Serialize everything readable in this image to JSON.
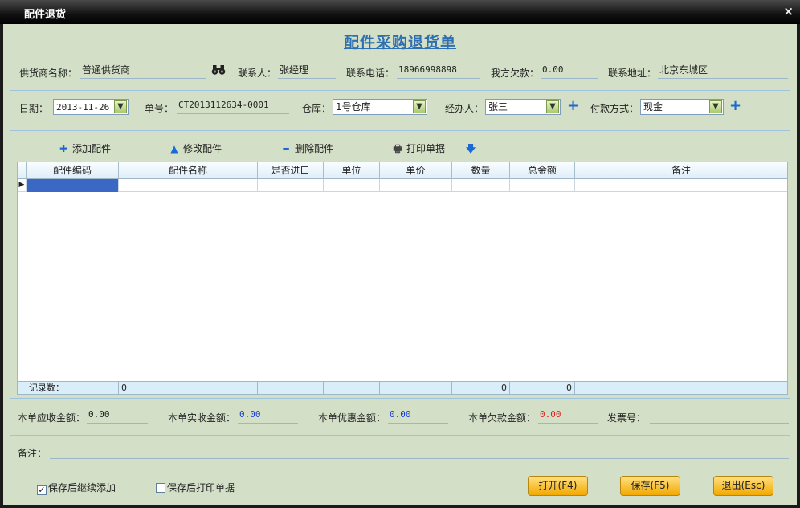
{
  "window": {
    "title": "配件退货",
    "close": "×"
  },
  "heading": "配件采购退货单",
  "row1": {
    "supplier_label": "供货商名称：",
    "supplier_value": "普通供货商",
    "contact_label": "联系人：",
    "contact_value": "张经理",
    "phone_label": "联系电话：",
    "phone_value": "18966998898",
    "owe_label": "我方欠款：",
    "owe_value": "0.00",
    "address_label": "联系地址：",
    "address_value": "北京东城区"
  },
  "row2": {
    "date_label": "日期：",
    "date_value": "2013-11-26",
    "no_label": "单号：",
    "no_value": "CT2013112634-0001",
    "warehouse_label": "仓库：",
    "warehouse_value": "1号仓库",
    "handler_label": "经办人：",
    "handler_value": "张三",
    "payment_label": "付款方式：",
    "payment_value": "现金"
  },
  "toolbar": {
    "add": "添加配件",
    "edit": "修改配件",
    "delete": "删除配件",
    "print": "打印单据"
  },
  "grid": {
    "columns": [
      "配件编码",
      "配件名称",
      "是否进口",
      "单位",
      "单价",
      "数量",
      "总金额",
      "备注"
    ],
    "footer": {
      "label": "记录数：",
      "count": "0",
      "qty_total": "0",
      "amount_total": "0"
    }
  },
  "totals": {
    "receivable_label": "本单应收金额：",
    "receivable_value": "0.00",
    "received_label": "本单实收金额：",
    "received_value": "0.00",
    "discount_label": "本单优惠金额：",
    "discount_value": "0.00",
    "arrears_label": "本单欠款金额：",
    "arrears_value": "0.00",
    "invoice_label": "发票号：",
    "invoice_value": ""
  },
  "remark": {
    "label": "备注：",
    "value": ""
  },
  "options": {
    "continue_add": "保存后继续添加",
    "continue_add_checked": true,
    "print_after": "保存后打印单据",
    "print_after_checked": false
  },
  "buttons": {
    "open": "打开(F4)",
    "save": "保存(F5)",
    "exit": "退出(Esc)"
  },
  "colors": {
    "client_bg": "#d4dfc7",
    "heading": "#2e6fb0",
    "received_value": "#1a3fd0",
    "arrears_value": "#e02020",
    "button": "#f2a800"
  },
  "icons": {
    "binoculars": "binoculars-icon",
    "plus": "plus-icon",
    "up": "arrow-up-icon",
    "minus": "minus-icon",
    "printer": "printer-icon",
    "down": "arrow-down-icon"
  }
}
